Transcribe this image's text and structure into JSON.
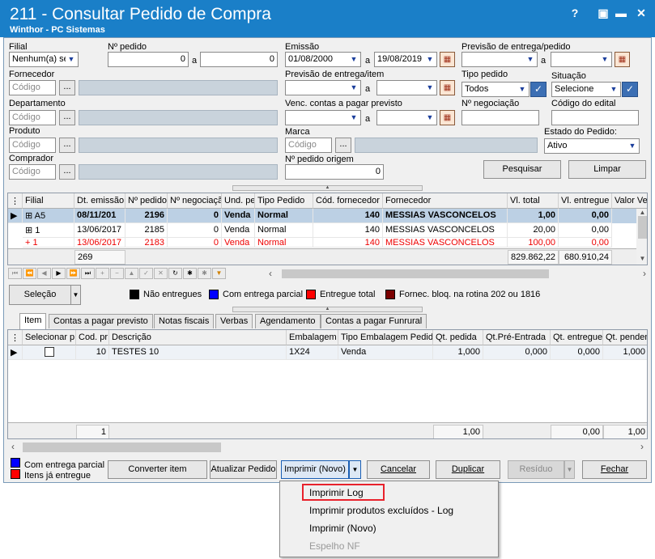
{
  "window": {
    "title": "211 - Consultar Pedido de Compra",
    "subtitle": "Winthor - PC Sistemas",
    "help": "?",
    "restore": "▣",
    "minimize": "▬",
    "close": "✕"
  },
  "filters": {
    "filial_label": "Filial",
    "filial_value": "Nenhum(a) se",
    "pedido_label": "Nº pedido",
    "pedido_from": "0",
    "pedido_to": "0",
    "to_sep": "a",
    "emissao_label": "Emissão",
    "emissao_from": "01/08/2000",
    "emissao_to": "19/08/2019",
    "previsao_pedido_label": "Previsão de entrega/pedido",
    "fornecedor_label": "Fornecedor",
    "codigo_ph": "Código",
    "dots": "...",
    "previsao_item_label": "Previsão de entrega/item",
    "tipo_pedido_label": "Tipo pedido",
    "tipo_pedido_value": "Todos",
    "situacao_label": "Situação",
    "situacao_value": "Selecione",
    "departamento_label": "Departamento",
    "venc_label": "Venc. contas a  pagar previsto",
    "negociacao_label": "Nº negociação",
    "edital_label": "Código do edital",
    "produto_label": "Produto",
    "marca_label": "Marca",
    "estado_label": "Estado do Pedido:",
    "estado_value": "Ativo",
    "comprador_label": "Comprador",
    "pedido_origem_label": "Nº pedido origem",
    "pedido_origem_value": "0",
    "pesquisar": "Pesquisar",
    "limpar": "Limpar"
  },
  "orders": {
    "columns": [
      "Filial",
      "Dt. emissão",
      "Nº pedido",
      "Nº negociaçã",
      "Und. pe",
      "Tipo Pedido",
      "Cód. fornecedor",
      "Fornecedor",
      "Vl. total",
      "Vl. entregue",
      "Valor Ve"
    ],
    "rows": [
      [
        "A5",
        "08/11/201",
        "2196",
        "0",
        "Venda",
        "Normal",
        "140",
        "MESSIAS VASCONCELOS",
        "1,00",
        "0,00"
      ],
      [
        "1",
        "13/06/2017",
        "2185",
        "0",
        "Venda",
        "Normal",
        "140",
        "MESSIAS VASCONCELOS",
        "20,00",
        "0,00"
      ],
      [
        "1",
        "13/06/2017",
        "2183",
        "0",
        "Venda",
        "Normal",
        "140",
        "MESSIAS VASCONCELOS",
        "100,00",
        "0,00"
      ]
    ],
    "footer": {
      "count": "269",
      "total": "829.862,22",
      "entregue": "680.910,24"
    }
  },
  "legend": {
    "selecao": "Seleção",
    "items": [
      {
        "label": "Não entregues",
        "color": "#000000"
      },
      {
        "label": "Com entrega parcial",
        "color": "#0000ff"
      },
      {
        "label": "Entregue total",
        "color": "#ff0000"
      },
      {
        "label": "Fornec. bloq. na rotina 202 ou 1816",
        "color": "#7a0000"
      }
    ]
  },
  "tabs": [
    "Item",
    "Contas a pagar previsto",
    "Notas fiscais",
    "Verbas",
    "Agendamento",
    "Contas a pagar Funrural"
  ],
  "items": {
    "columns": [
      "Selecionar p",
      "Cod. pr",
      "Descrição",
      "Embalagem",
      "Tipo Embalagem Pedido",
      "Qt. pedida",
      "Qt.Pré-Entrada",
      "Qt. entregue",
      "Qt. pendente"
    ],
    "row": {
      "cod": "10",
      "descricao": "TESTES 10",
      "embalagem": "1X24",
      "tipo": "Venda",
      "qt_pedida": "1,000",
      "qt_pre": "0,000",
      "qt_entregue": "0,000",
      "qt_pendente": "1,000"
    },
    "footer": {
      "count": "1",
      "qt_pedida": "1,00",
      "qt_entregue": "0,00",
      "qt_pendente": "1,00"
    }
  },
  "bottom": {
    "legend1": "Com entrega parcial",
    "legend2": "Itens já entregue",
    "converter": "Converter item",
    "atualizar": "Atualizar Pedido",
    "imprimir": "Imprimir (Novo)",
    "cancelar": "Cancelar",
    "duplicar": "Duplicar",
    "residuo": "Resíduo",
    "fechar": "Fechar"
  },
  "menu": [
    "Imprimir Log",
    "Imprimir produtos excluídos - Log",
    "Imprimir (Novo)",
    "Espelho NF"
  ],
  "colors": {
    "title_bar": "#1a7fc8",
    "selected_row": "#bcd0e4",
    "highlight_box": "#e8222c"
  }
}
